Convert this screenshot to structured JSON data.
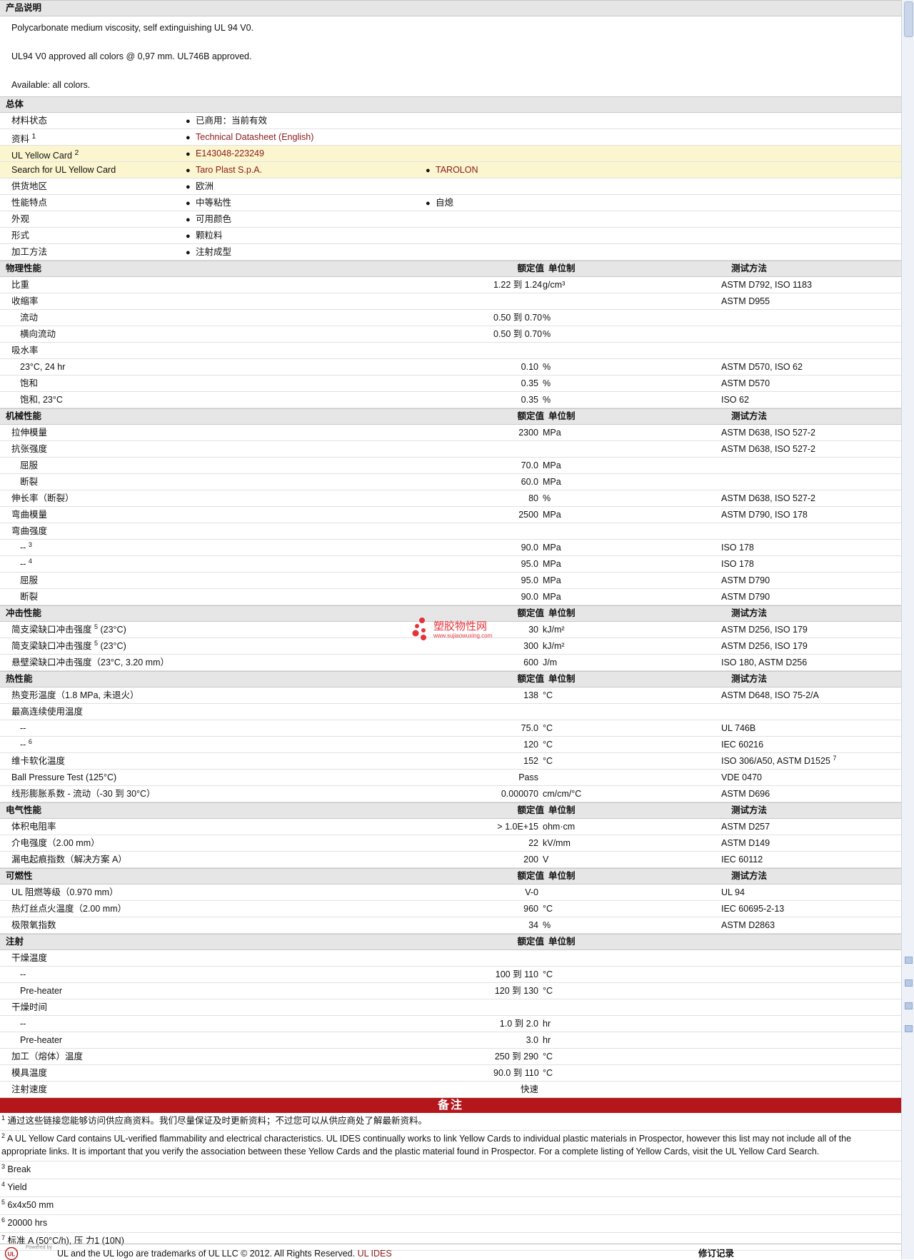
{
  "sections": {
    "description": {
      "title": "产品说明",
      "lines": [
        "Polycarbonate medium viscosity, self extinguishing UL 94 V0.",
        "UL94 V0 approved all colors @ 0,97 mm. UL746B approved.",
        "Available: all colors."
      ]
    },
    "general": {
      "title": "总体",
      "rows": [
        {
          "label": "材料状态",
          "items": [
            "已商用：当前有效"
          ]
        },
        {
          "label": "资料",
          "sup": "1",
          "items": [
            "Technical Datasheet (English)"
          ],
          "link": true
        },
        {
          "label": "UL Yellow Card",
          "sup": "2",
          "items": [
            "E143048-223249"
          ],
          "link": true,
          "yellow": true
        },
        {
          "label": "Search for UL Yellow Card",
          "items": [
            "Taro Plast S.p.A.",
            "TAROLON"
          ],
          "link": true,
          "yellow": true
        },
        {
          "label": "供货地区",
          "items": [
            "欧洲"
          ]
        },
        {
          "label": "性能特点",
          "items": [
            "中等粘性",
            "自熄"
          ]
        },
        {
          "label": "外观",
          "items": [
            "可用颜色"
          ]
        },
        {
          "label": "形式",
          "items": [
            "颗粒料"
          ]
        },
        {
          "label": "加工方法",
          "items": [
            "注射成型"
          ]
        }
      ]
    }
  },
  "table_headers": {
    "value": "额定值",
    "unit": "单位制",
    "method": "测试方法"
  },
  "property_groups": [
    {
      "title": "物理性能",
      "show_method": true,
      "rows": [
        {
          "label": "比重",
          "value": "1.22 到  1.24",
          "unit": "g/cm³",
          "method": "ASTM D792, ISO 1183"
        },
        {
          "label": "收缩率",
          "method": "ASTM D955"
        },
        {
          "label": "流动",
          "sub": true,
          "value": "0.50 到  0.70",
          "unit": "%"
        },
        {
          "label": "横向流动",
          "sub": true,
          "value": "0.50 到  0.70",
          "unit": "%"
        },
        {
          "label": "吸水率"
        },
        {
          "label": "23°C, 24 hr",
          "sub": true,
          "value": "0.10",
          "unit": "%",
          "method": "ASTM D570, ISO 62"
        },
        {
          "label": "饱和",
          "sub": true,
          "value": "0.35",
          "unit": "%",
          "method": "ASTM D570"
        },
        {
          "label": "饱和, 23°C",
          "sub": true,
          "value": "0.35",
          "unit": "%",
          "method": "ISO 62"
        }
      ]
    },
    {
      "title": "机械性能",
      "show_method": true,
      "rows": [
        {
          "label": "拉伸模量",
          "value": "2300",
          "unit": "MPa",
          "method": "ASTM D638, ISO 527-2"
        },
        {
          "label": "抗张强度",
          "method": "ASTM D638, ISO 527-2"
        },
        {
          "label": "屈服",
          "sub": true,
          "value": "70.0",
          "unit": "MPa"
        },
        {
          "label": "断裂",
          "sub": true,
          "value": "60.0",
          "unit": "MPa"
        },
        {
          "label": "伸长率（断裂）",
          "value": "80",
          "unit": "%",
          "method": "ASTM D638, ISO 527-2"
        },
        {
          "label": "弯曲模量",
          "value": "2500",
          "unit": "MPa",
          "method": "ASTM D790, ISO 178"
        },
        {
          "label": "弯曲强度"
        },
        {
          "label": "--",
          "sup": "3",
          "sub": true,
          "value": "90.0",
          "unit": "MPa",
          "method": "ISO 178"
        },
        {
          "label": "--",
          "sup": "4",
          "sub": true,
          "value": "95.0",
          "unit": "MPa",
          "method": "ISO 178"
        },
        {
          "label": "屈服",
          "sub": true,
          "value": "95.0",
          "unit": "MPa",
          "method": "ASTM D790"
        },
        {
          "label": "断裂",
          "sub": true,
          "value": "90.0",
          "unit": "MPa",
          "method": "ASTM D790"
        }
      ]
    },
    {
      "title": "冲击性能",
      "show_method": true,
      "rows": [
        {
          "label": "简支梁缺口冲击强度",
          "sup": "5",
          "label_after": " (23°C)",
          "value": "30",
          "unit": "kJ/m²",
          "method": "ASTM D256, ISO 179"
        },
        {
          "label": "简支梁缺口冲击强度",
          "sup": "5",
          "label_after": " (23°C)",
          "value": "300",
          "unit": "kJ/m²",
          "method": "ASTM D256, ISO 179"
        },
        {
          "label": "悬壁梁缺口冲击强度（23°C, 3.20 mm）",
          "value": "600",
          "unit": "J/m",
          "method": "ISO 180, ASTM D256"
        }
      ]
    },
    {
      "title": "热性能",
      "show_method": true,
      "rows": [
        {
          "label": "热变形温度（1.8 MPa, 未退火）",
          "value": "138",
          "unit": "°C",
          "method": "ASTM D648, ISO 75-2/A"
        },
        {
          "label": "最高连续使用温度"
        },
        {
          "label": "--",
          "sub": true,
          "value": "75.0",
          "unit": "°C",
          "method": "UL 746B"
        },
        {
          "label": "--",
          "sup": "6",
          "sub": true,
          "value": "120",
          "unit": "°C",
          "method": "IEC 60216"
        },
        {
          "label": "维卡软化温度",
          "value": "152",
          "unit": "°C",
          "method": "ISO 306/A50, ASTM D1525",
          "method_sup": "7"
        },
        {
          "label": "Ball Pressure Test (125°C)",
          "value": "Pass",
          "unit": "",
          "method": "VDE 0470"
        },
        {
          "label": "线形膨胀系数 - 流动（-30 到  30°C）",
          "value": "0.000070",
          "unit": "cm/cm/°C",
          "method": "ASTM D696"
        }
      ]
    },
    {
      "title": "电气性能",
      "show_method": true,
      "rows": [
        {
          "label": "体积电阻率",
          "value": "> 1.0E+15",
          "unit": "ohm·cm",
          "method": "ASTM D257"
        },
        {
          "label": "介电强度（2.00 mm）",
          "value": "22",
          "unit": "kV/mm",
          "method": "ASTM D149"
        },
        {
          "label": "漏电起痕指数（解决方案 A）",
          "value": "200",
          "unit": "V",
          "method": "IEC 60112"
        }
      ]
    },
    {
      "title": "可燃性",
      "show_method": true,
      "rows": [
        {
          "label": "UL 阻燃等级（0.970 mm）",
          "value": "V-0",
          "unit": "",
          "method": "UL 94"
        },
        {
          "label": "热灯丝点火温度（2.00 mm）",
          "value": "960",
          "unit": "°C",
          "method": "IEC 60695-2-13"
        },
        {
          "label": "极限氧指数",
          "value": "34",
          "unit": "%",
          "method": "ASTM D2863"
        }
      ]
    },
    {
      "title": "注射",
      "show_method": false,
      "rows": [
        {
          "label": "干燥温度"
        },
        {
          "label": "--",
          "sub": true,
          "value": "100 到  110",
          "unit": "°C"
        },
        {
          "label": "Pre-heater",
          "sub": true,
          "value": "120 到  130",
          "unit": "°C"
        },
        {
          "label": "干燥时间"
        },
        {
          "label": "--",
          "sub": true,
          "value": "1.0 到  2.0",
          "unit": "hr"
        },
        {
          "label": "Pre-heater",
          "sub": true,
          "value": "3.0",
          "unit": "hr"
        },
        {
          "label": "加工（熔体）温度",
          "value": "250 到  290",
          "unit": "°C"
        },
        {
          "label": "模具温度",
          "value": "90.0 到  110",
          "unit": "°C"
        },
        {
          "label": "注射速度",
          "value": "快速",
          "unit": ""
        }
      ]
    }
  ],
  "notes": {
    "title": "备注",
    "items": [
      {
        "num": "1",
        "text": "通过这些链接您能够访问供应商资料。我们尽量保证及时更新资料；不过您可以从供应商处了解最新资料。"
      },
      {
        "num": "2",
        "text": "A UL Yellow Card contains UL-verified flammability and electrical characteristics. UL IDES continually works to link Yellow Cards to individual plastic materials in Prospector, however this list may not include all of the appropriate links. It is important that you verify the association between these Yellow Cards and the plastic material found in Prospector. For a complete listing of Yellow Cards, visit the UL Yellow Card Search."
      },
      {
        "num": "3",
        "text": "Break"
      },
      {
        "num": "4",
        "text": "Yield"
      },
      {
        "num": "5",
        "text": "6x4x50 mm"
      },
      {
        "num": "6",
        "text": "20000 hrs"
      },
      {
        "num": "7",
        "text": "标准 A (50°C/h), 压 力1 (10N)"
      }
    ]
  },
  "footer": {
    "powered_by": "Powered by",
    "text": "UL and the UL logo are trademarks of UL LLC © 2012. All Rights Reserved.",
    "link": "UL IDES",
    "revision": "修订记录"
  },
  "watermark": {
    "text": "塑胶物性网",
    "sub": "www.sujiaowuxing.com"
  },
  "colors": {
    "notes_bar": "#b3161b",
    "link": "#8a1a1a",
    "yellow_row": "#fbf6cf",
    "section_bg": "#e6e6e6"
  }
}
